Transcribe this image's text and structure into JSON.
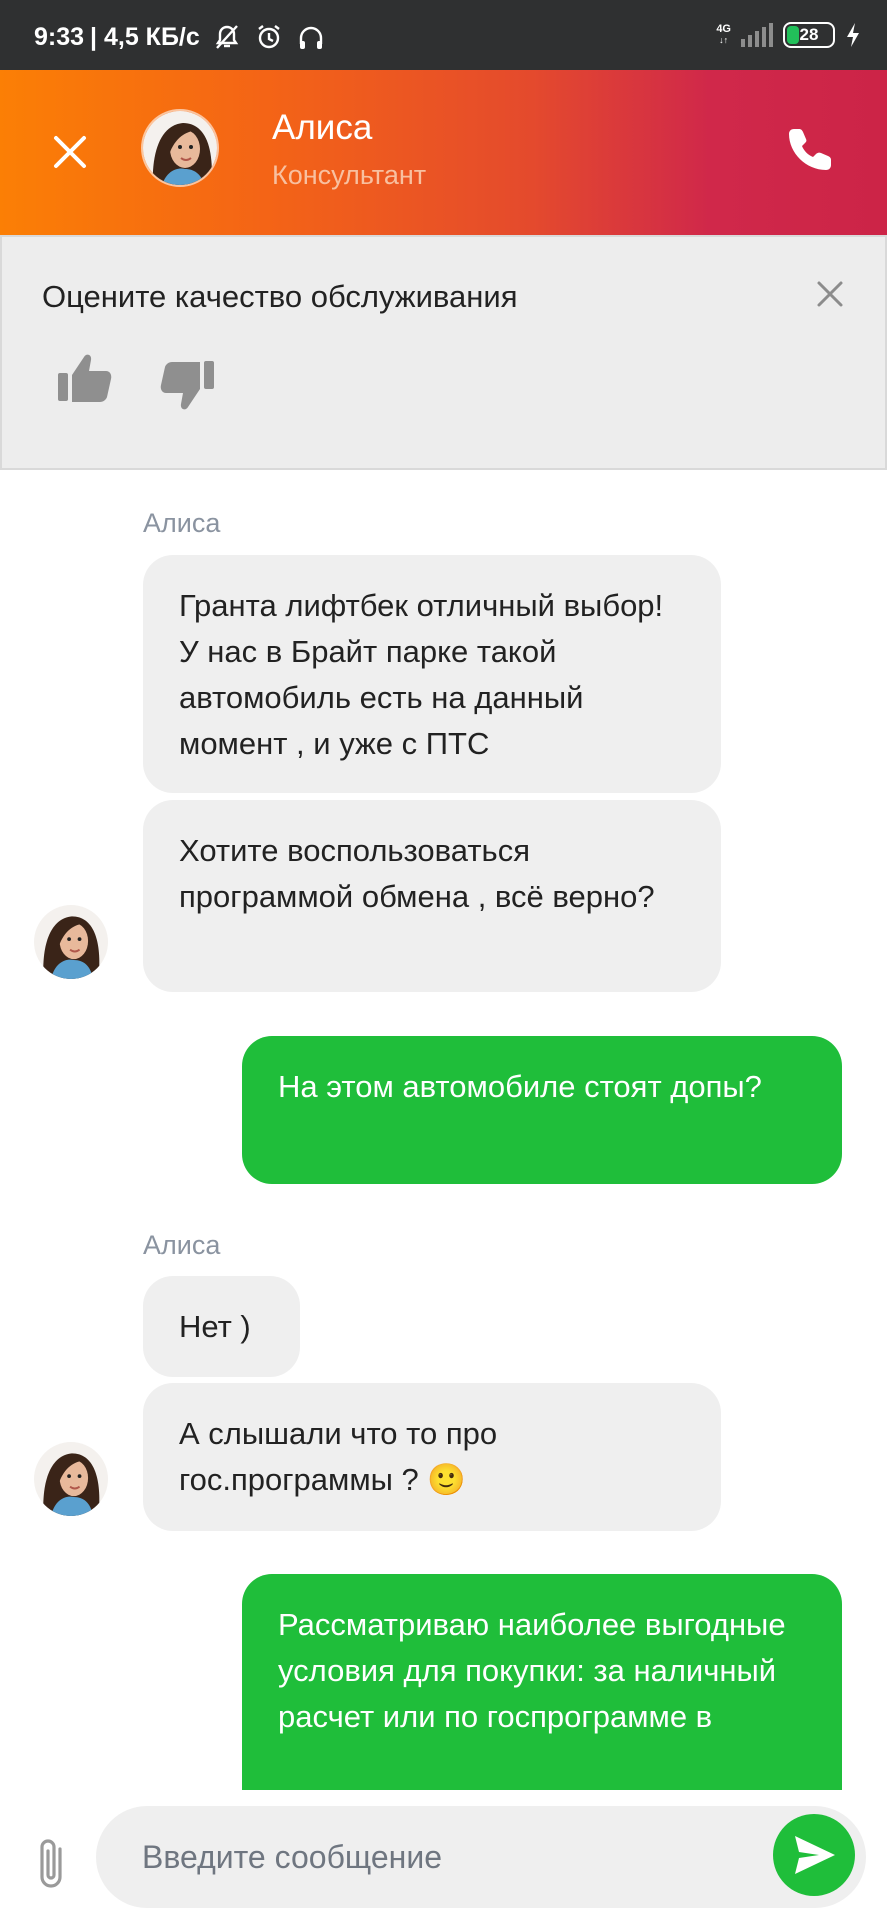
{
  "status_bar": {
    "time": "9:33",
    "network_speed": "| 4,5 КБ/с",
    "network_type": "4G",
    "battery": "28",
    "icons": [
      "mute-icon",
      "alarm-icon",
      "headphones-icon",
      "signal-icon",
      "battery-icon",
      "charging-icon"
    ]
  },
  "header": {
    "name": "Алиса",
    "role": "Консультант",
    "icons": [
      "close-icon",
      "avatar",
      "phone-icon"
    ],
    "colors": {
      "gradient_start": "#fb7f05",
      "gradient_end": "#cc2447"
    }
  },
  "rating": {
    "title": "Оцените качество обслуживания",
    "icons": [
      "close-icon",
      "thumbs-up-icon",
      "thumbs-down-icon"
    ]
  },
  "messages": {
    "group1": {
      "sender": "Алиса",
      "bubble1": "Гранта лифтбек отличный выбор! У нас в Брайт парке такой автомобиль есть на данный момент , и уже с ПТС",
      "bubble2": "Хотите воспользоваться программой обмена , всё верно?"
    },
    "user1": "На этом автомобиле стоят допы?",
    "group2": {
      "sender": "Алиса",
      "bubble1": "Нет )",
      "bubble2": "А слышали что то про гос.программы ? 🙂"
    },
    "user2": "Рассматриваю наиболее выгодные условия для покупки: за наличный расчет или по госпрограмме в"
  },
  "composer": {
    "placeholder": "Введите сообщение",
    "icons": [
      "paperclip-icon",
      "send-icon"
    ],
    "colors": {
      "accent": "#1fbe3a"
    }
  }
}
